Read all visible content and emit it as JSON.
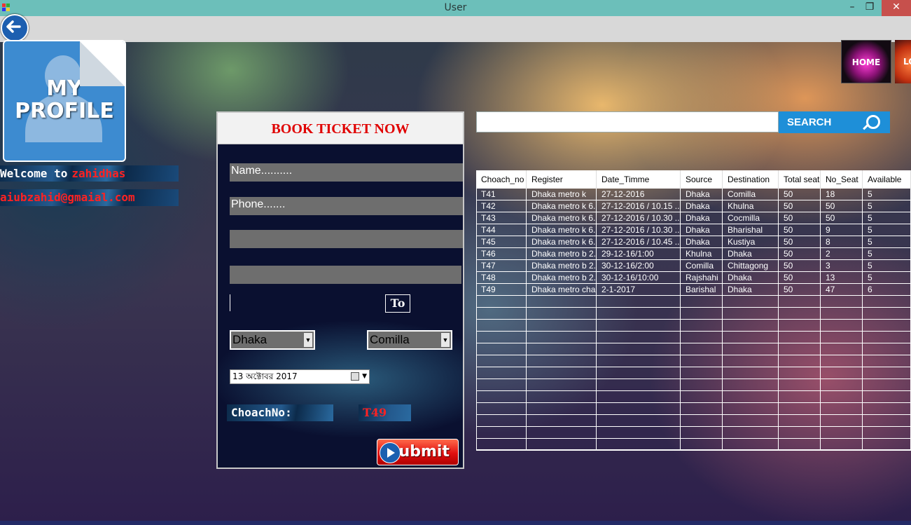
{
  "window": {
    "title": "User",
    "minimize": "–",
    "maximize": "❐",
    "close": "✕"
  },
  "profile": {
    "line1": "MY",
    "line2": "PROFILE"
  },
  "user": {
    "welcome_label": "Welcome to",
    "name": "zahidhas",
    "email": "aiubzahid@gmaial.com"
  },
  "booking": {
    "heading": "BOOK TICKET NOW",
    "name_value": "Name..........",
    "phone_value": "Phone.......",
    "field3_value": "",
    "field4_value": "",
    "to_label": "To",
    "from_city": "Dhaka",
    "to_city": "Comilla",
    "date_value": "13  অক্টোবর  2017",
    "coach_label": "ChoachNo:",
    "coach_value": "T49",
    "submit_label": "Submit"
  },
  "nav": {
    "home_label": "HOME",
    "logout_label": "LO"
  },
  "search": {
    "value": "",
    "button_label": "SEARCH"
  },
  "table": {
    "columns": [
      "Choach_no",
      "Register",
      "Date_Timme",
      "Source",
      "Destination",
      "Total seat",
      "No_Seat",
      "Available"
    ],
    "rows": [
      [
        "T41",
        "Dhaka metro k",
        "27-12-2016",
        "Dhaka",
        "Comilla",
        "50",
        "18",
        "5"
      ],
      [
        "T42",
        "Dhaka metro k 6...",
        "27-12-2016 / 10.15 ...",
        "Dhaka",
        "Khulna",
        "50",
        "50",
        "5"
      ],
      [
        "T43",
        "Dhaka metro k 6...",
        "27-12-2016 / 10.30 ...",
        "Dhaka",
        "Cocmilla",
        "50",
        "50",
        "5"
      ],
      [
        "T44",
        "Dhaka metro k 6...",
        "27-12-2016 / 10.30 ...",
        "Dhaka",
        "Bharishal",
        "50",
        "9",
        "5"
      ],
      [
        "T45",
        "Dhaka metro k 6...",
        "27-12-2016 / 10.45 ...",
        "Dhaka",
        "Kustiya",
        "50",
        "8",
        "5"
      ],
      [
        "T46",
        "Dhaka metro b 2...",
        "29-12-16/1:00",
        "Khulna",
        "Dhaka",
        "50",
        "2",
        "5"
      ],
      [
        "T47",
        "Dhaka metro b 2...",
        "30-12-16/2:00",
        "Comilla",
        "Chittagong",
        "50",
        "3",
        "5"
      ],
      [
        "T48",
        "Dhaka metro b 2...",
        "30-12-16/10:00",
        "Rajshahi",
        "Dhaka",
        "50",
        "13",
        "5"
      ],
      [
        "T49",
        "Dhaka metro cha",
        "2-1-2017",
        "Barishal",
        "Dhaka",
        "50",
        "47",
        "6"
      ]
    ]
  },
  "colors": {
    "accent_blue": "#1e8fd8",
    "heading_red": "#e00000",
    "titlebar": "#6cbfba"
  }
}
